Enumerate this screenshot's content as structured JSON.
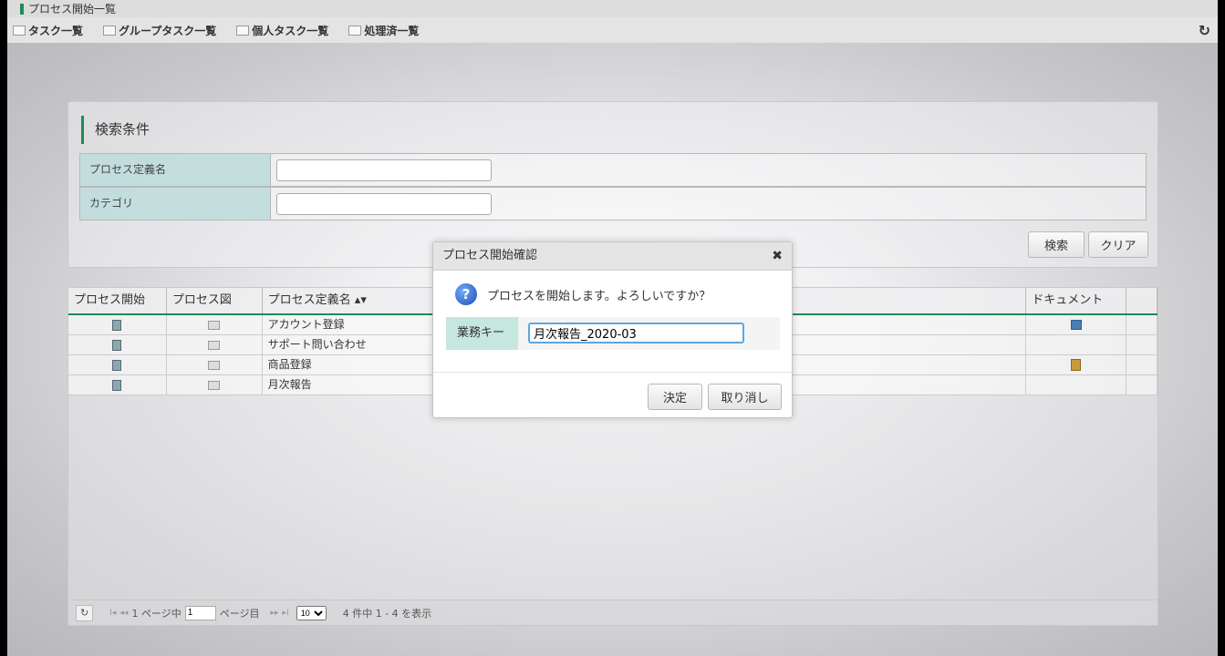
{
  "window_title": "プロセス開始一覧",
  "menu": [
    {
      "label": "タスク一覧"
    },
    {
      "label": "グループタスク一覧"
    },
    {
      "label": "個人タスク一覧"
    },
    {
      "label": "処理済一覧"
    }
  ],
  "search": {
    "title": "検索条件",
    "fields": [
      {
        "label": "プロセス定義名",
        "value": ""
      },
      {
        "label": "カテゴリ",
        "value": ""
      }
    ],
    "search_label": "検索",
    "clear_label": "クリア"
  },
  "grid": {
    "columns": [
      "プロセス開始",
      "プロセス図",
      "プロセス定義名 ▴▾",
      "ドキュメント"
    ],
    "rows": [
      {
        "name": "アカウント登録",
        "doc_icon": "external-link-icon"
      },
      {
        "name": "サポート問い合わせ",
        "doc_icon": ""
      },
      {
        "name": "商品登録",
        "doc_icon": "book-icon"
      },
      {
        "name": "月次報告",
        "doc_icon": ""
      }
    ]
  },
  "pager": {
    "prefix": "1 ページ中",
    "page": "1",
    "suffix": "ページ目",
    "page_size": "10",
    "summary": "4 件中 1 - 4 を表示"
  },
  "dialog": {
    "title": "プロセス開始確認",
    "message": "プロセスを開始します。よろしいですか？",
    "field_label": "業務キー",
    "field_value": "月次報告_2020-03",
    "ok_label": "決定",
    "cancel_label": "取り消し"
  },
  "colors": {
    "accent": "#1f8a5a",
    "label_bg": "#bcdada",
    "focus_border": "#5aa8e0"
  }
}
